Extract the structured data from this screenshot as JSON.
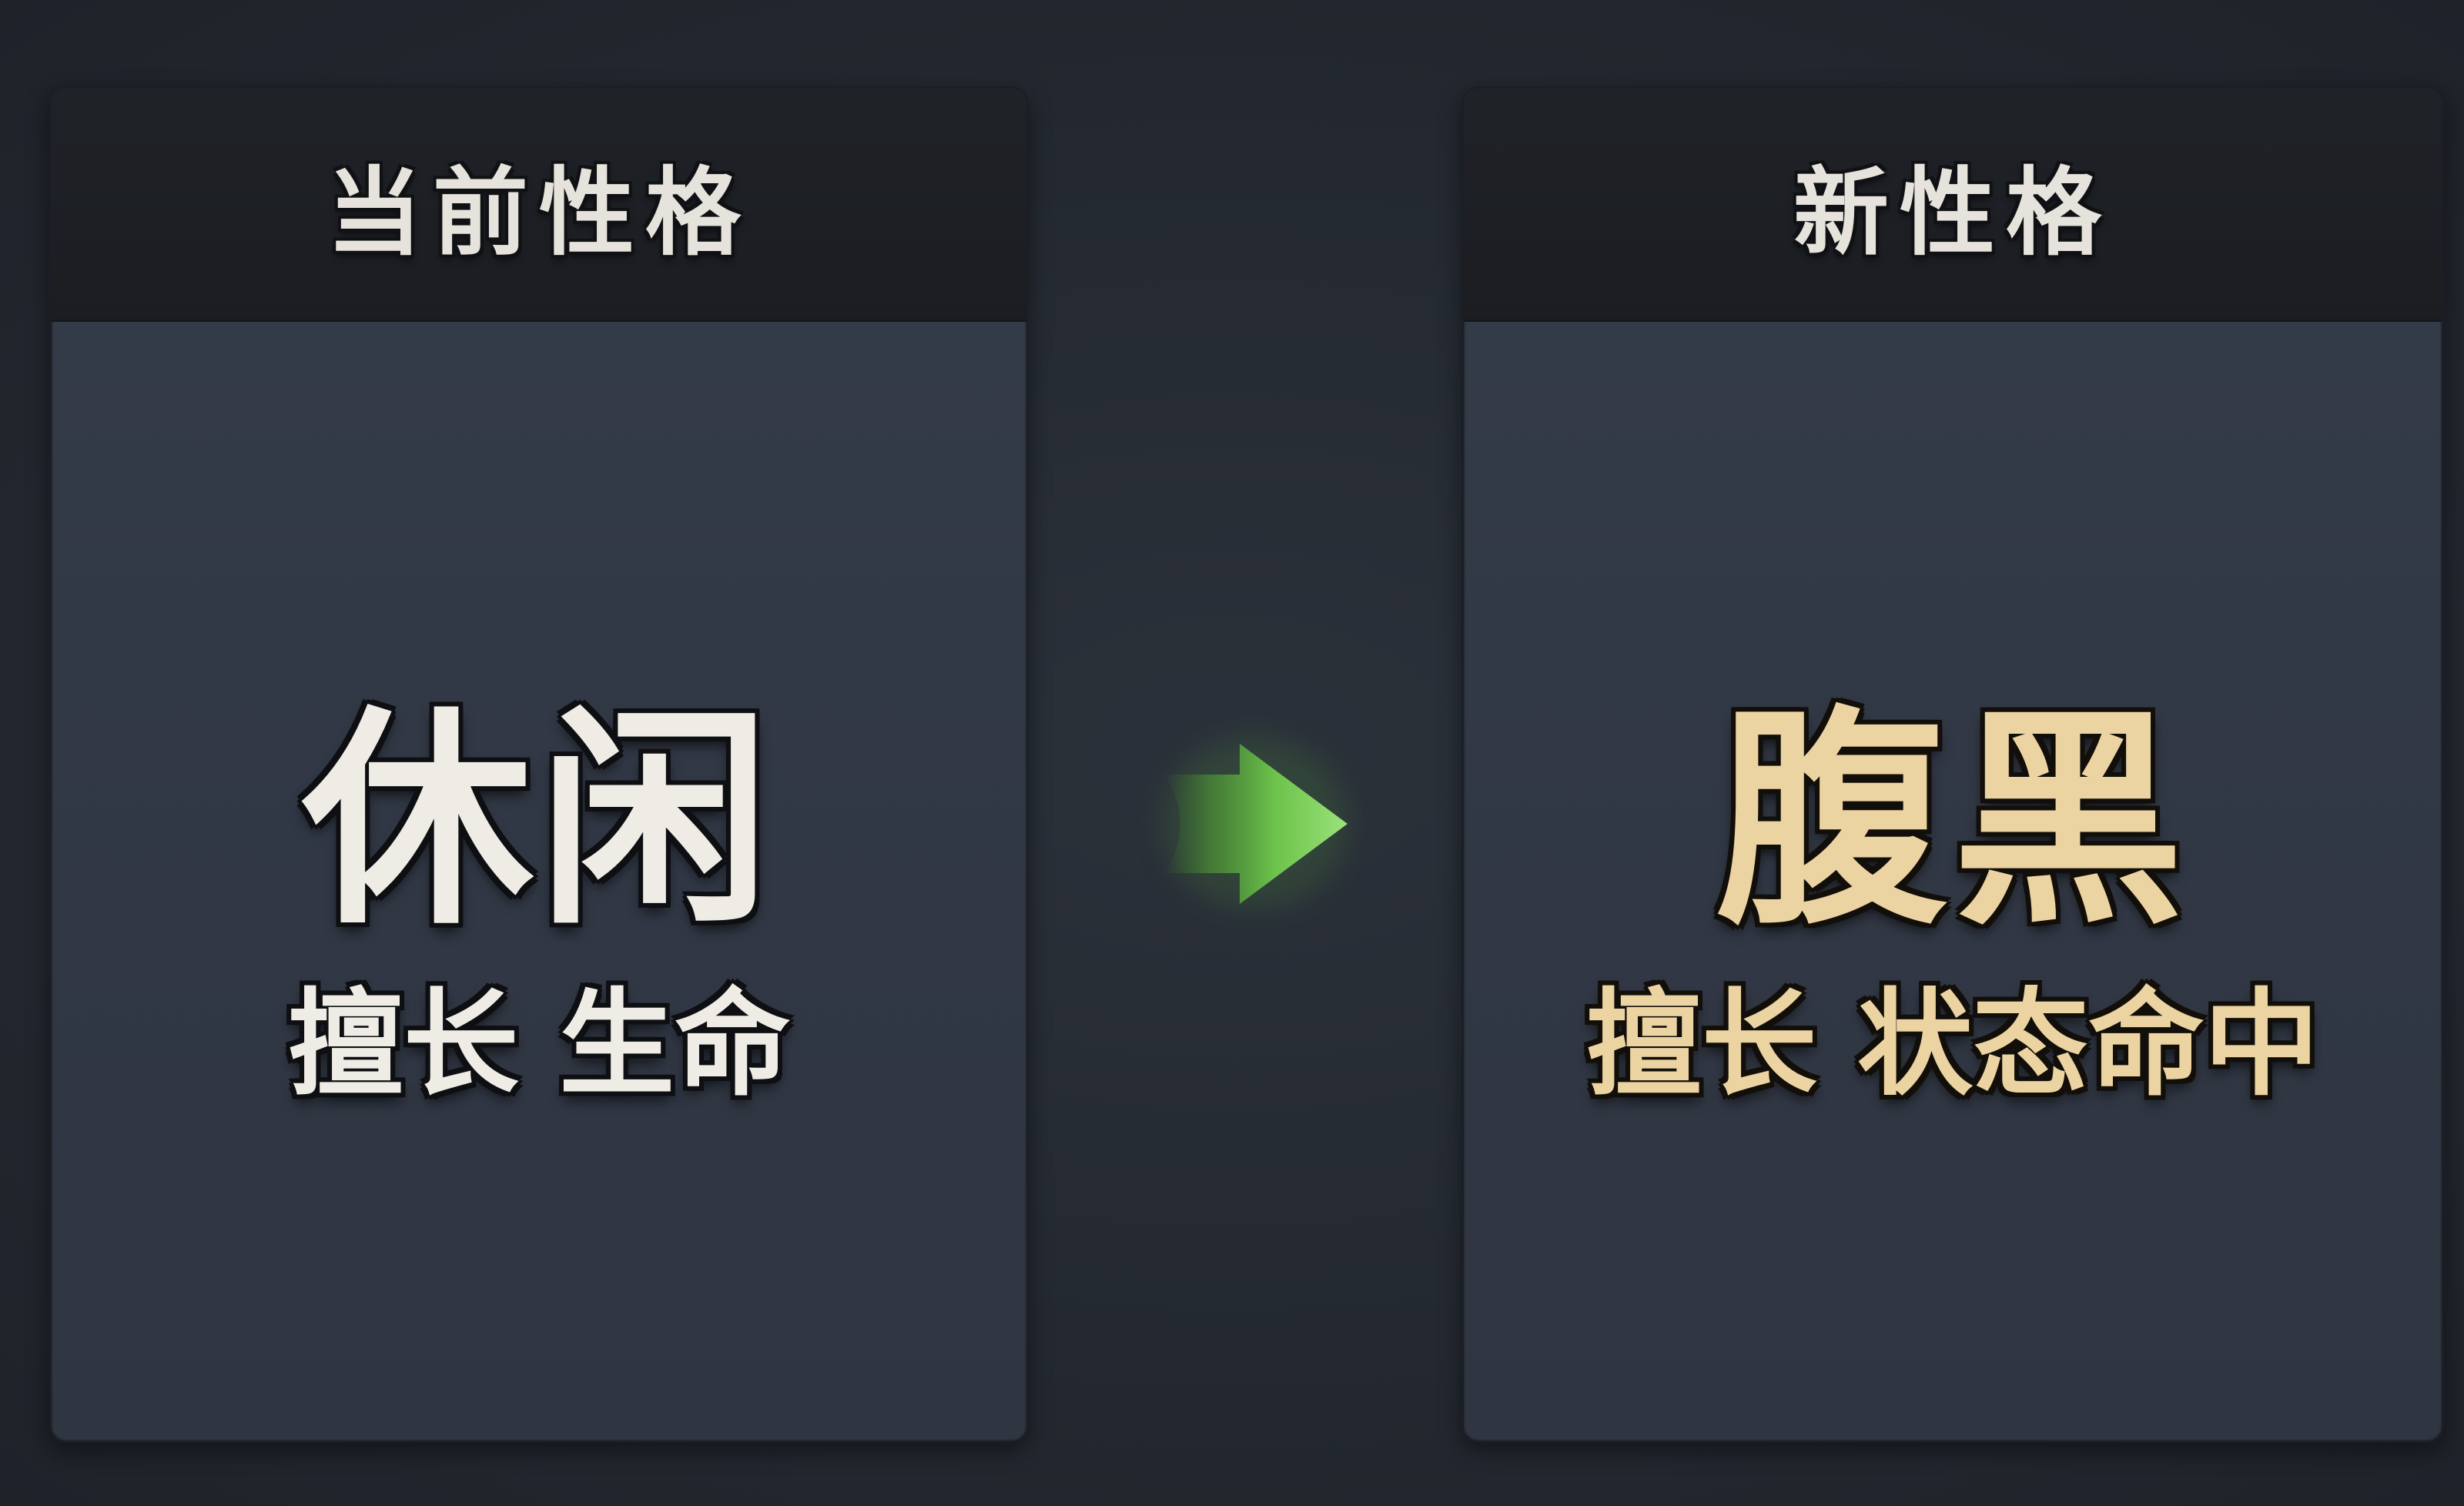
{
  "current_card": {
    "header": "当前性格",
    "personality_name": "休闲",
    "specialty_text": "擅长 生命"
  },
  "new_card": {
    "header": "新性格",
    "personality_name": "腹黑",
    "specialty_text": "擅长 状态命中"
  },
  "transition": {
    "icon": "arrow-right-icon",
    "accent_color": "#7ed65a"
  },
  "colors": {
    "current_text": "#efece6",
    "new_text": "#ecd3a2"
  }
}
